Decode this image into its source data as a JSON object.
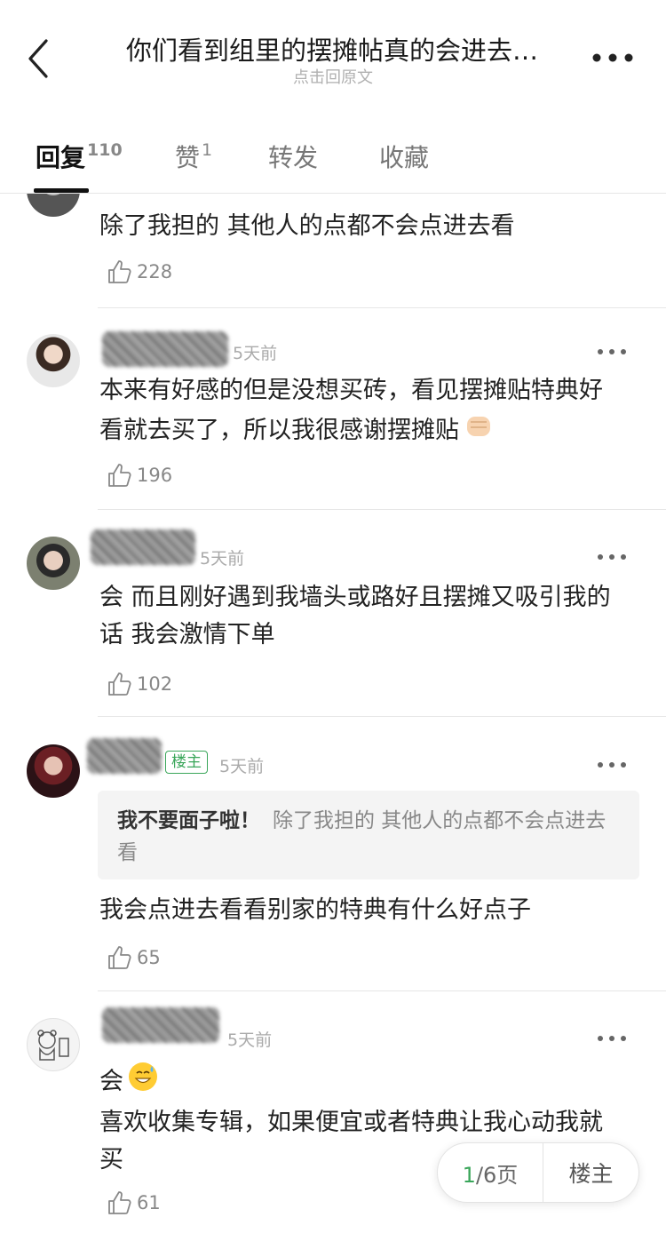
{
  "header": {
    "title": "你们看到组里的摆摊帖真的会进去…",
    "subtitle": "点击回原文"
  },
  "tabs": [
    {
      "label": "回复",
      "count": "110"
    },
    {
      "label": "赞",
      "count": "1"
    },
    {
      "label": "转发"
    },
    {
      "label": "收藏"
    }
  ],
  "posts": [
    {
      "content": "除了我担的 其他人的点都不会点进去看",
      "likes": "228"
    },
    {
      "time": "5天前",
      "content": "本来有好感的但是没想买砖，看见摆摊贴特典好看就去买了，所以我很感谢摆摊贴",
      "emoji": "fist-emoji",
      "likes": "196"
    },
    {
      "time": "5天前",
      "content": "会 而且刚好遇到我墙头或路好且摆摊又吸引我的话 我会激情下单",
      "likes": "102"
    },
    {
      "time": "5天前",
      "badge": "楼主",
      "quote_author": "我不要面子啦！",
      "quote_text": "除了我担的 其他人的点都不会点进去看",
      "content": "我会点进去看看别家的特典有什么好点子",
      "likes": "65"
    },
    {
      "time": "5天前",
      "content_line1": "会",
      "emoji": "sweat-smile-emoji",
      "content_rest": "喜欢收集专辑，如果便宜或者特典让我心动我就买",
      "likes": "61"
    }
  ],
  "pager": {
    "current": "1",
    "total": "/6页",
    "op_filter": "楼主"
  },
  "colors": {
    "accent_green": "#3aa65a",
    "text_main": "#222222",
    "text_muted": "#888888"
  }
}
